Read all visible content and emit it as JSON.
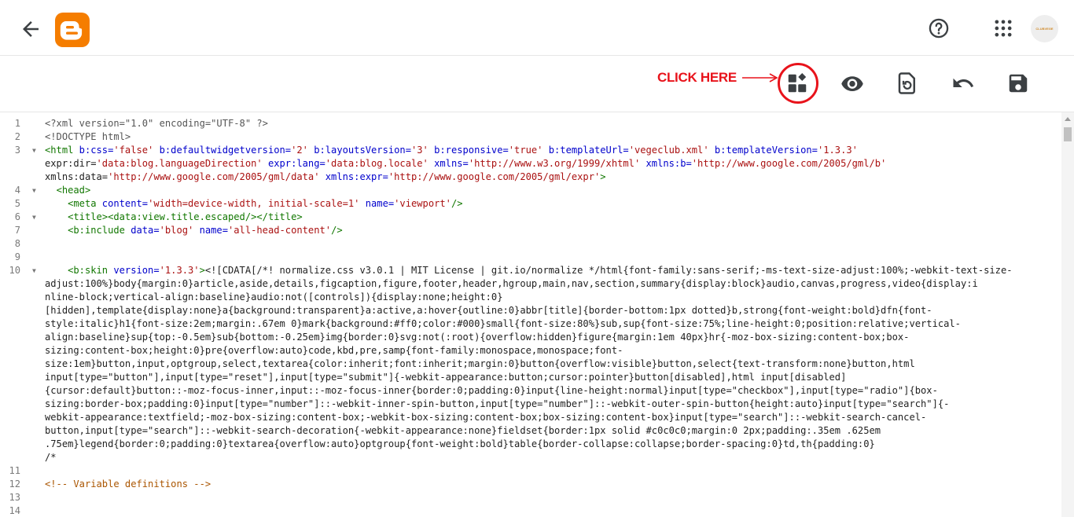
{
  "header": {
    "back_icon": "arrow-left-icon",
    "logo_icon": "blogger-logo-icon",
    "help_icon": "help-circle-icon",
    "apps_icon": "apps-grid-icon",
    "avatar_text": "CLUBVEGE"
  },
  "toolbar": {
    "annotation": "CLICK HERE",
    "annotation_color": "#e8131b",
    "buttons": [
      {
        "icon": "theme-widgets-icon"
      },
      {
        "icon": "eye-preview-icon"
      },
      {
        "icon": "restore-icon"
      },
      {
        "icon": "undo-icon"
      },
      {
        "icon": "save-floppy-icon"
      }
    ]
  },
  "editor": {
    "line_numbers": [
      "1",
      "2",
      "3",
      "",
      "",
      "4",
      "5",
      "6",
      "7",
      "8",
      "9",
      "10",
      "",
      "",
      "",
      "",
      "",
      "",
      "",
      "",
      "",
      "",
      "",
      "",
      "",
      "",
      "11",
      "12",
      "13",
      "14"
    ],
    "folds": [
      "3",
      "4",
      "6",
      "10"
    ],
    "lines": [
      "<?xml version=\"1.0\" encoding=\"UTF-8\" ?>",
      "<!DOCTYPE html>",
      "<html b:css='false' b:defaultwidgetversion='2' b:layoutsVersion='3' b:responsive='true' b:templateUrl='vegeclub.xml' b:templateVersion='1.3.3'",
      "expr:dir='data:blog.languageDirection' expr:lang='data:blog.locale' xmlns='http://www.w3.org/1999/xhtml' xmlns:b='http://www.google.com/2005/gml/b'",
      "xmlns:data='http://www.google.com/2005/gml/data' xmlns:expr='http://www.google.com/2005/gml/expr'>",
      "  <head>",
      "    <meta content='width=device-width, initial-scale=1' name='viewport'/>",
      "    <title><data:view.title.escaped/></title>",
      "    <b:include data='blog' name='all-head-content'/>",
      "",
      "",
      "    <b:skin version='1.3.3'><![CDATA[/*! normalize.css v3.0.1 | MIT License | git.io/normalize */html{font-family:sans-serif;-ms-text-size-adjust:100%;-webkit-text-size-",
      "adjust:100%}body{margin:0}article,aside,details,figcaption,figure,footer,header,hgroup,main,nav,section,summary{display:block}audio,canvas,progress,video{display:i",
      "nline-block;vertical-align:baseline}audio:not([controls]){display:none;height:0}",
      "[hidden],template{display:none}a{background:transparent}a:active,a:hover{outline:0}abbr[title]{border-bottom:1px dotted}b,strong{font-weight:bold}dfn{font-",
      "style:italic}h1{font-size:2em;margin:.67em 0}mark{background:#ff0;color:#000}small{font-size:80%}sub,sup{font-size:75%;line-height:0;position:relative;vertical-",
      "align:baseline}sup{top:-0.5em}sub{bottom:-0.25em}img{border:0}svg:not(:root){overflow:hidden}figure{margin:1em 40px}hr{-moz-box-sizing:content-box;box-",
      "sizing:content-box;height:0}pre{overflow:auto}code,kbd,pre,samp{font-family:monospace,monospace;font-",
      "size:1em}button,input,optgroup,select,textarea{color:inherit;font:inherit;margin:0}button{overflow:visible}button,select{text-transform:none}button,html",
      "input[type=\"button\"],input[type=\"reset\"],input[type=\"submit\"]{-webkit-appearance:button;cursor:pointer}button[disabled],html input[disabled]",
      "{cursor:default}button::-moz-focus-inner,input::-moz-focus-inner{border:0;padding:0}input{line-height:normal}input[type=\"checkbox\"],input[type=\"radio\"]{box-",
      "sizing:border-box;padding:0}input[type=\"number\"]::-webkit-inner-spin-button,input[type=\"number\"]::-webkit-outer-spin-button{height:auto}input[type=\"search\"]{-",
      "webkit-appearance:textfield;-moz-box-sizing:content-box;-webkit-box-sizing:content-box;box-sizing:content-box}input[type=\"search\"]::-webkit-search-cancel-",
      "button,input[type=\"search\"]::-webkit-search-decoration{-webkit-appearance:none}fieldset{border:1px solid #c0c0c0;margin:0 2px;padding:.35em .625em",
      ".75em}legend{border:0;padding:0}textarea{overflow:auto}optgroup{font-weight:bold}table{border-collapse:collapse;border-spacing:0}td,th{padding:0}",
      "/*",
      "",
      "<!-- Variable definitions -->",
      ""
    ]
  }
}
